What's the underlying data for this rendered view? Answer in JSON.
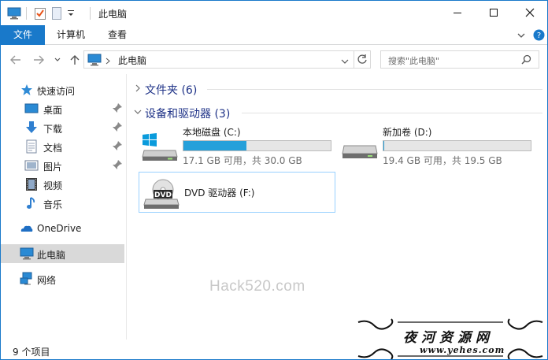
{
  "window": {
    "title": "此电脑"
  },
  "window_controls": {
    "minimize_icon": "minimize-icon",
    "maximize_icon": "maximize-icon",
    "close_icon": "close-icon"
  },
  "ribbon": {
    "tabs": [
      {
        "label": "文件",
        "active": true
      },
      {
        "label": "计算机",
        "active": false
      },
      {
        "label": "查看",
        "active": false
      }
    ]
  },
  "address_bar": {
    "path": "此电脑"
  },
  "search": {
    "placeholder": "搜索\"此电脑\""
  },
  "sidebar": {
    "items": [
      {
        "label": "快速访问",
        "icon": "star-icon"
      },
      {
        "label": "桌面",
        "icon": "desktop-icon",
        "pinned": true
      },
      {
        "label": "下载",
        "icon": "download-icon",
        "pinned": true
      },
      {
        "label": "文档",
        "icon": "documents-icon",
        "pinned": true
      },
      {
        "label": "图片",
        "icon": "pictures-icon",
        "pinned": true
      },
      {
        "label": "视频",
        "icon": "videos-icon"
      },
      {
        "label": "音乐",
        "icon": "music-icon"
      },
      {
        "label": "OneDrive",
        "icon": "onedrive-icon"
      },
      {
        "label": "此电脑",
        "icon": "this-pc-icon",
        "selected": true
      },
      {
        "label": "网络",
        "icon": "network-icon"
      }
    ]
  },
  "content": {
    "folders_group": {
      "title": "文件夹 (6)"
    },
    "drives_group": {
      "title": "设备和驱动器 (3)"
    },
    "drives": [
      {
        "name": "本地磁盘 (C:)",
        "space": "17.1 GB 可用，共 30.0 GB",
        "used_fraction": 0.43
      },
      {
        "name": "新加卷 (D:)",
        "space": "19.4 GB 可用，共 19.5 GB",
        "used_fraction": 0.005
      },
      {
        "name": "DVD 驱动器 (F:)"
      }
    ]
  },
  "watermark": "Hack520.com",
  "status": {
    "item_count": "9 个项目"
  },
  "stamp": {
    "chinese": "夜河资源网",
    "url": "www.yehes.com"
  },
  "colors": {
    "accent": "#1979ca",
    "progress": "#26a0da",
    "group_title": "#1e3287",
    "selection": "#d9d9d9"
  }
}
